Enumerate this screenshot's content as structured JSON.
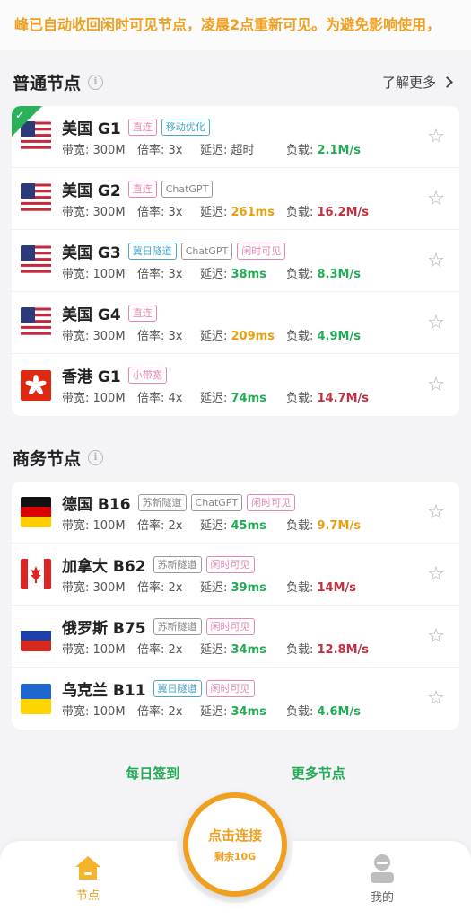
{
  "notice": "峰已自动收回闲时可见节点，凌晨2点重新可见。为避免影响使用，",
  "sections": [
    {
      "title": "普通节点",
      "learn_more": "了解更多",
      "nodes": [
        {
          "flag": "us",
          "name": "美国 G1",
          "tags": [
            {
              "text": "直连",
              "color": "pink"
            },
            {
              "text": "移动优化",
              "color": "teal"
            }
          ],
          "bandwidth": "带宽: 300M",
          "rate": "倍率: 3x",
          "latency_label": "延迟: ",
          "latency": "超时",
          "load_label": "负载: ",
          "load": "2.1M/s",
          "selected": true
        },
        {
          "flag": "us",
          "name": "美国 G2",
          "tags": [
            {
              "text": "直连",
              "color": "pink"
            },
            {
              "text": "ChatGPT",
              "color": "gray"
            }
          ],
          "bandwidth": "带宽: 300M",
          "rate": "倍率: 3x",
          "latency_label": "延迟: ",
          "latency": "261ms",
          "load_label": "负载: ",
          "load": "16.2M/s"
        },
        {
          "flag": "us",
          "name": "美国 G3",
          "tags": [
            {
              "text": "冀日隧道",
              "color": "teal"
            },
            {
              "text": "ChatGPT",
              "color": "gray"
            },
            {
              "text": "闲时可见",
              "color": "pink"
            }
          ],
          "bandwidth": "带宽: 100M",
          "rate": "倍率: 3x",
          "latency_label": "延迟: ",
          "latency": "38ms",
          "load_label": "负载: ",
          "load": "8.3M/s"
        },
        {
          "flag": "us",
          "name": "美国 G4",
          "tags": [
            {
              "text": "直连",
              "color": "pink"
            }
          ],
          "bandwidth": "带宽: 300M",
          "rate": "倍率: 3x",
          "latency_label": "延迟: ",
          "latency": "209ms",
          "load_label": "负载: ",
          "load": "4.9M/s"
        },
        {
          "flag": "hk",
          "name": "香港 G1",
          "tags": [
            {
              "text": "小带宽",
              "color": "pink"
            }
          ],
          "bandwidth": "带宽: 100M",
          "rate": "倍率: 4x",
          "latency_label": "延迟: ",
          "latency": "74ms",
          "load_label": "负载: ",
          "load": "14.7M/s"
        }
      ]
    },
    {
      "title": "商务节点",
      "nodes": [
        {
          "flag": "de",
          "name": "德国 B16",
          "tags": [
            {
              "text": "苏新隧道",
              "color": "gray"
            },
            {
              "text": "ChatGPT",
              "color": "gray"
            },
            {
              "text": "闲时可见",
              "color": "pink"
            }
          ],
          "bandwidth": "带宽: 100M",
          "rate": "倍率: 2x",
          "latency_label": "延迟: ",
          "latency": "45ms",
          "load_label": "负载: ",
          "load": "9.7M/s"
        },
        {
          "flag": "ca",
          "name": "加拿大 B62",
          "tags": [
            {
              "text": "苏新隧道",
              "color": "gray"
            },
            {
              "text": "闲时可见",
              "color": "pink"
            }
          ],
          "bandwidth": "带宽: 300M",
          "rate": "倍率: 2x",
          "latency_label": "延迟: ",
          "latency": "39ms",
          "load_label": "负载: ",
          "load": "14M/s"
        },
        {
          "flag": "ru",
          "name": "俄罗斯 B75",
          "tags": [
            {
              "text": "苏新隧道",
              "color": "gray"
            },
            {
              "text": "闲时可见",
              "color": "pink"
            }
          ],
          "bandwidth": "带宽: 100M",
          "rate": "倍率: 2x",
          "latency_label": "延迟: ",
          "latency": "34ms",
          "load_label": "负载: ",
          "load": "12.8M/s"
        },
        {
          "flag": "ua",
          "name": "乌克兰 B11",
          "tags": [
            {
              "text": "冀日隧道",
              "color": "teal"
            },
            {
              "text": "闲时可见",
              "color": "pink"
            }
          ],
          "bandwidth": "带宽: 100M",
          "rate": "倍率: 2x",
          "latency_label": "延迟: ",
          "latency": "34ms",
          "load_label": "负载: ",
          "load": "4.6M/s"
        }
      ]
    }
  ],
  "links": {
    "checkin": "每日签到",
    "more_nodes": "更多节点"
  },
  "connect": {
    "main": "点击连接",
    "sub": "剩余10G"
  },
  "tabs": {
    "home": "节点",
    "me": "我的"
  },
  "colors": {
    "accent": "#f0a020",
    "green": "#22aa55",
    "orange": "#e8a010",
    "red": "#c03040"
  }
}
